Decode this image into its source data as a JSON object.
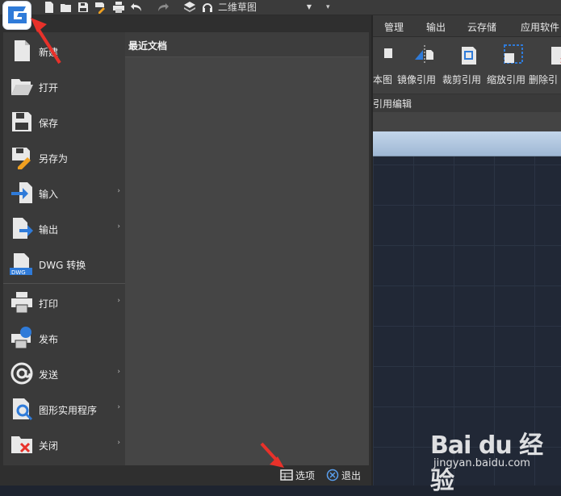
{
  "quick_access": {
    "workspace": "二维草图",
    "items": [
      "new-file-icon",
      "open-folder-icon",
      "save-icon",
      "save-as-icon",
      "print-icon",
      "undo-icon",
      "redo-icon",
      "layers-icon",
      "headset-icon"
    ]
  },
  "ribbon": {
    "tabs": [
      "管理",
      "输出",
      "云存储",
      "应用软件"
    ],
    "buttons": [
      "本图",
      "镜像引用",
      "裁剪引用",
      "缩放引用",
      "删除引"
    ],
    "group_label": "引用编辑"
  },
  "app_menu": {
    "items": [
      {
        "label": "新建",
        "icon": "new-file-icon",
        "submenu": false
      },
      {
        "label": "打开",
        "icon": "open-folder-icon",
        "submenu": false
      },
      {
        "label": "保存",
        "icon": "save-icon",
        "submenu": false
      },
      {
        "label": "另存为",
        "icon": "save-as-icon",
        "submenu": false
      },
      {
        "label": "输入",
        "icon": "import-icon",
        "submenu": true
      },
      {
        "label": "输出",
        "icon": "export-icon",
        "submenu": true
      },
      {
        "label": "DWG 转换",
        "icon": "dwg-convert-icon",
        "submenu": false
      },
      {
        "label": "打印",
        "icon": "print-icon",
        "submenu": true
      },
      {
        "label": "发布",
        "icon": "publish-icon",
        "submenu": false
      },
      {
        "label": "发送",
        "icon": "email-icon",
        "submenu": true
      },
      {
        "label": "图形实用程序",
        "icon": "drawing-utilities-icon",
        "submenu": true
      },
      {
        "label": "关闭",
        "icon": "close-file-icon",
        "submenu": true
      }
    ],
    "recent_title": "最近文档",
    "options_label": "选项",
    "exit_label": "退出",
    "submenu_arrow": "›"
  },
  "watermark": {
    "main": "Bai du 经验",
    "sub": "jingyan.baidu.com"
  },
  "colors": {
    "accent_blue": "#2f7bd9",
    "menu_bg": "#3a3a3a",
    "annotation_red": "#e8312a"
  }
}
